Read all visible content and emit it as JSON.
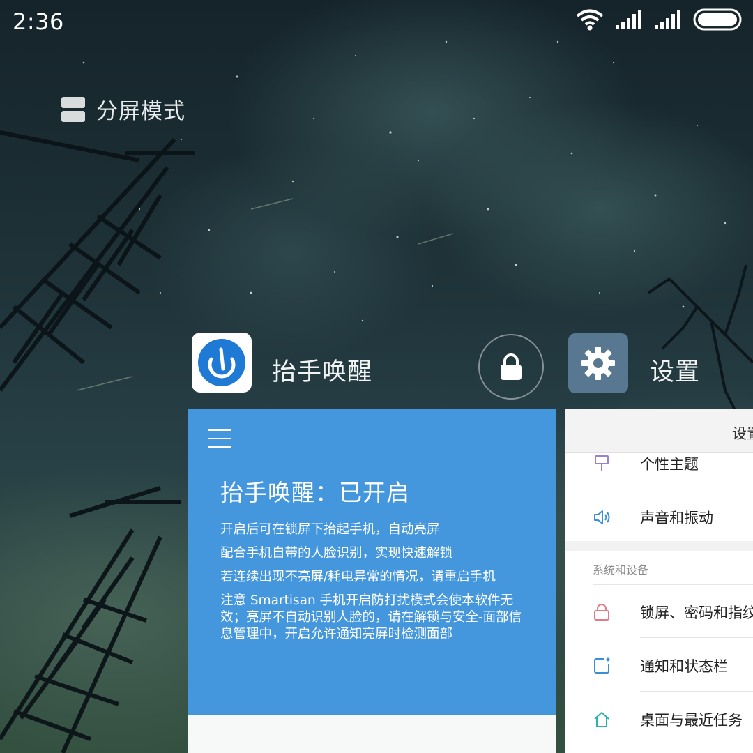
{
  "status_bar": {
    "time": "2:36",
    "icons": [
      "wifi-icon",
      "signal-icon",
      "signal-icon",
      "battery-icon"
    ]
  },
  "split_screen": {
    "label": "分屏模式",
    "icon": "split-screen-icon"
  },
  "apps": {
    "raise_to_wake": {
      "title": "抬手唤醒",
      "icon": "raise-to-wake-app-icon",
      "icon_color": "#1f7ad6",
      "card": {
        "heading": "抬手唤醒：已开启",
        "lines": [
          "开启后可在锁屏下抬起手机，自动亮屏",
          "配合手机自带的人脸识别，实现快速解锁",
          "若连续出现不亮屏/耗电异常的情况，请重启手机",
          "注意 Smartisan 手机开启防打扰模式会使本软件无效；亮屏不自动识别人脸的，请在解锁与安全-面部信息管理中，开启允许通知亮屏时检测面部"
        ],
        "background": "#4497dc"
      }
    },
    "lock": {
      "icon": "lock-icon"
    },
    "settings": {
      "title": "设置",
      "icon": "gear-icon",
      "icon_bg": "#587892",
      "card": {
        "topbar_title": "设置",
        "items_top": [
          {
            "label": "个性主题",
            "icon": "brush-icon",
            "icon_color": "#9a7fd6"
          },
          {
            "label": "声音和振动",
            "icon": "speaker-icon",
            "icon_color": "#3a8fd8"
          }
        ],
        "section_title": "系统和设备",
        "items_bottom": [
          {
            "label": "锁屏、密码和指纹",
            "icon": "lock-outline-icon",
            "icon_color": "#e07b8a"
          },
          {
            "label": "通知和状态栏",
            "icon": "notification-icon",
            "icon_color": "#3a8fd8"
          },
          {
            "label": "桌面与最近任务",
            "icon": "home-icon",
            "icon_color": "#2bb3a8"
          }
        ]
      }
    }
  }
}
